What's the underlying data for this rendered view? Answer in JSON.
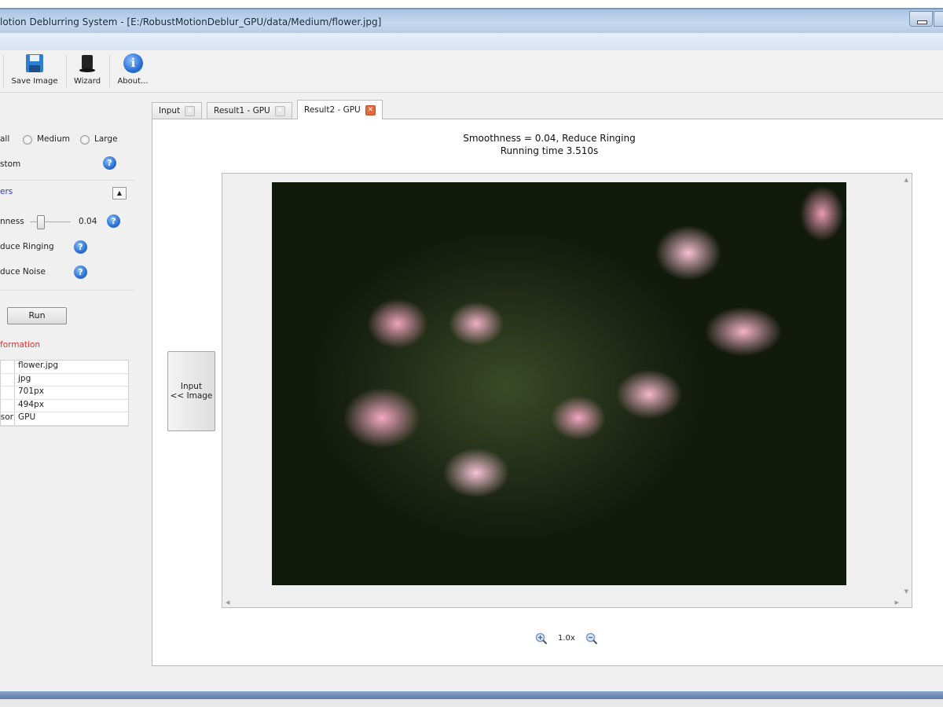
{
  "window": {
    "title": "lotion Deblurring System - [E:/RobustMotionDeblur_GPU/data/Medium/flower.jpg]"
  },
  "toolbar": {
    "items": [
      {
        "label": "Save Image",
        "icon": "floppy-disk-icon"
      },
      {
        "label": "Wizard",
        "icon": "magic-hat-icon"
      },
      {
        "label": "About...",
        "icon": "info-icon"
      }
    ]
  },
  "left": {
    "kernel_size": {
      "options": [
        "all",
        "Medium",
        "Large"
      ]
    },
    "custom_label": "stom",
    "params_group": "ers",
    "smoothness": {
      "label": "nness",
      "value": "0.04",
      "fraction": 0.1
    },
    "reduce_ringing": "duce Ringing",
    "reduce_noise": "duce Noise",
    "run_label": "Run",
    "info_title": "formation",
    "info_rows": [
      {
        "k": "",
        "v": "flower.jpg"
      },
      {
        "k": "",
        "v": "jpg"
      },
      {
        "k": "",
        "v": "701px"
      },
      {
        "k": "",
        "v": "494px"
      },
      {
        "k": "sor",
        "v": "GPU"
      }
    ]
  },
  "tabs": [
    {
      "label": "Input"
    },
    {
      "label": "Result1 - GPU"
    },
    {
      "label": "Result2 - GPU",
      "active": true
    }
  ],
  "result": {
    "line1": "Smoothness = 0.04, Reduce Ringing",
    "line2": "Running time 3.510s"
  },
  "input_button": {
    "line1": "Input",
    "line2": "<< Image"
  },
  "zoom": {
    "level": "1.0x"
  },
  "colors": {
    "accent": "#2a6fd6",
    "group_title": "#3333cc",
    "info_title": "#e8302f",
    "tab_close_active": "#e2693c"
  }
}
